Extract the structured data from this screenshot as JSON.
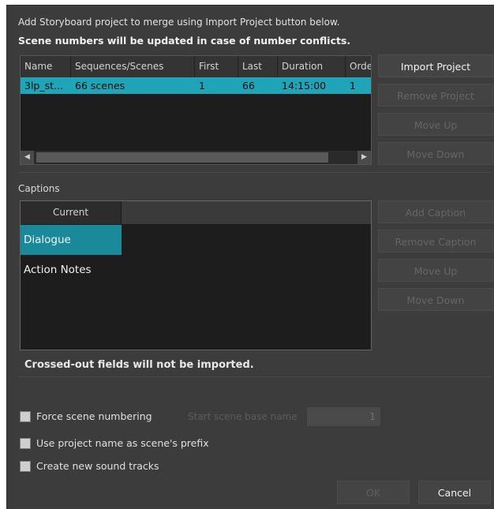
{
  "intro": {
    "line1": "Add Storyboard project to merge using Import Project button below.",
    "line2": "Scene numbers will be updated in case of number conflicts."
  },
  "project_table": {
    "headers": [
      "Name",
      "Sequences/Scenes",
      "First",
      "Last",
      "Duration",
      "Orde"
    ],
    "rows": [
      [
        "3lp_st...",
        "66 scenes",
        "1",
        "66",
        "14:15:00",
        "1"
      ]
    ]
  },
  "project_buttons": {
    "import": "Import Project",
    "remove": "Remove Project",
    "up": "Move Up",
    "down": "Move Down"
  },
  "captions": {
    "label": "Captions",
    "header": "Current",
    "items": [
      "Dialogue",
      "Action Notes"
    ]
  },
  "caption_buttons": {
    "add": "Add Caption",
    "remove": "Remove Caption",
    "up": "Move Up",
    "down": "Move Down"
  },
  "note": "Crossed-out fields will not be imported.",
  "options": {
    "force_numbering": "Force scene numbering",
    "start_base_label": "Start scene base name",
    "start_base_value": "1",
    "use_project_prefix": "Use project name as scene's prefix",
    "new_sound_tracks": "Create new sound tracks"
  },
  "footer": {
    "ok": "OK",
    "cancel": "Cancel"
  },
  "colors": {
    "background": "#3c3c3c",
    "selection": "#1fa4b8",
    "table_bg": "#1d1d1d"
  }
}
